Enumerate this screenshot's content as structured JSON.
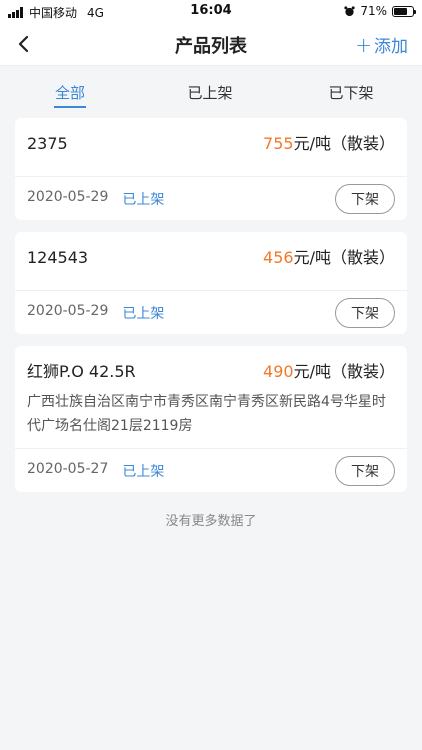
{
  "status_bar": {
    "carrier": "中国移动",
    "network": "4G",
    "time": "16:04",
    "battery": "71%",
    "battery_level": 0.71
  },
  "nav": {
    "title": "产品列表",
    "add_label": "添加"
  },
  "tabs": [
    {
      "label": "全部",
      "active": true
    },
    {
      "label": "已上架",
      "active": false
    },
    {
      "label": "已下架",
      "active": false
    }
  ],
  "products": [
    {
      "name": "2375",
      "price": "755",
      "unit": "元/吨（散装）",
      "address": "",
      "date": "2020-05-29",
      "status": "已上架",
      "action": "下架"
    },
    {
      "name": "124543",
      "price": "456",
      "unit": "元/吨（散装）",
      "address": "",
      "date": "2020-05-29",
      "status": "已上架",
      "action": "下架"
    },
    {
      "name": "红狮P.O 42.5R",
      "price": "490",
      "unit": "元/吨（散装）",
      "address": "广西壮族自治区南宁市青秀区南宁青秀区新民路4号华星时代广场名仕阁21层2119房",
      "date": "2020-05-27",
      "status": "已上架",
      "action": "下架"
    }
  ],
  "footer": {
    "no_more": "没有更多数据了"
  },
  "colors": {
    "accent": "#3d87d8",
    "price": "#f07a2a"
  }
}
